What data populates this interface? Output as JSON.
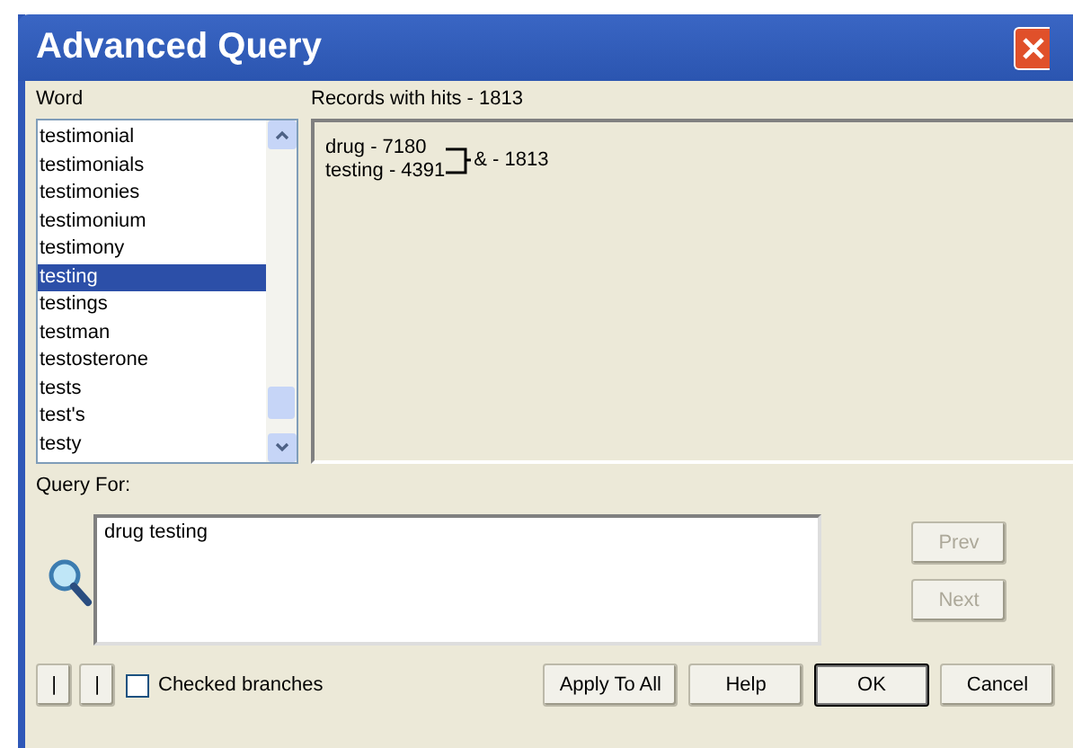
{
  "window": {
    "title": "Advanced Query"
  },
  "word_list": {
    "label": "Word",
    "items": [
      {
        "text": "testimonial",
        "selected": false
      },
      {
        "text": "testimonials",
        "selected": false
      },
      {
        "text": "testimonies",
        "selected": false
      },
      {
        "text": "testimonium",
        "selected": false
      },
      {
        "text": "testimony",
        "selected": false
      },
      {
        "text": "testing",
        "selected": true
      },
      {
        "text": "testings",
        "selected": false
      },
      {
        "text": "testman",
        "selected": false
      },
      {
        "text": "testosterone",
        "selected": false
      },
      {
        "text": "tests",
        "selected": false
      },
      {
        "text": "test's",
        "selected": false
      },
      {
        "text": "testy",
        "selected": false
      }
    ]
  },
  "records": {
    "label": "Records with hits - 1813",
    "terms": [
      "drug - 7180",
      "testing - 4391"
    ],
    "combined": "& - 1813"
  },
  "query": {
    "label": "Query For:",
    "value": "drug testing"
  },
  "side_buttons": [
    {
      "label": "Prev",
      "disabled": true
    },
    {
      "label": "Next",
      "disabled": true
    }
  ],
  "paren_buttons": [
    "|",
    "|"
  ],
  "checked_branches": {
    "label": "Checked branches",
    "checked": false
  },
  "buttons": [
    {
      "label": "Apply To All",
      "default": false
    },
    {
      "label": "Help",
      "default": false
    },
    {
      "label": "OK",
      "default": true
    },
    {
      "label": "Cancel",
      "default": false
    }
  ]
}
